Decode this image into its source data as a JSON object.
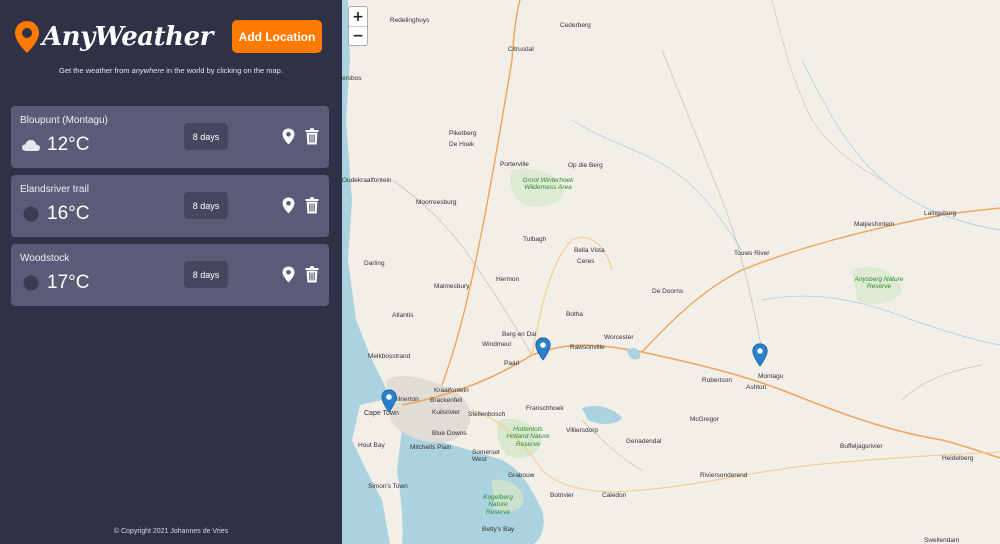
{
  "app": {
    "title": "AnyWeather",
    "add_button": "Add Location",
    "tagline_before": "Get the weather from ",
    "tagline_em": "anywhere",
    "tagline_after": " in the world by clicking on the map.",
    "copyright": "© Copyright 2021 Johannes de Vries",
    "accent_color": "#ff7a00",
    "sidebar_color": "#2f3146",
    "card_color": "#5a5b77"
  },
  "locations": [
    {
      "name": "Bloupunt (Montagu)",
      "temp": "12°C",
      "icon": "cloud-icon",
      "days": "8 days"
    },
    {
      "name": "Elandsriver trail",
      "temp": "16°C",
      "icon": "unknown-weather-icon",
      "days": "8 days"
    },
    {
      "name": "Woodstock",
      "temp": "17°C",
      "icon": "unknown-weather-icon",
      "days": "8 days"
    }
  ],
  "map": {
    "zoom_in": "+",
    "zoom_out": "−",
    "labels": {
      "redelinghuys": "Redelinghuys",
      "cederberg": "Cederberg",
      "citrusdal": "Citrusdal",
      "lambertsbay": "ersbos",
      "piketberg": "Piketberg",
      "dehoek": "De Hoek",
      "porterville": "Porterville",
      "opdieberg": "Op die Berg",
      "groot": "Groot Winterhoek Wilderness Area",
      "oudekraal": "Oudekraalfontein",
      "moorreesburg": "Moorreesburg",
      "tulbagh": "Tulbagh",
      "bellavista": "Bella Vista",
      "ceres": "Ceres",
      "darling": "Darling",
      "hermon": "Hermon",
      "touwsrivier": "Touws River",
      "matjiesfontein": "Matjiesfontein",
      "laingsburg": "Laingsburg",
      "anysberg": "Anysberg Nature Reserve",
      "malmesbury": "Malmesbury",
      "dedoorns": "De Doorns",
      "atlantis": "Atlantis",
      "botha": "Botha",
      "bergendal": "Berg en Dal",
      "windmeul": "Windmeul",
      "worcester": "Worcester",
      "rawsonville": "Rawsonville",
      "melkbos": "Melkbosstrand",
      "paarl": "Paarl",
      "montagu": "Montagu",
      "robertson": "Robertson",
      "ashton": "Ashton",
      "kraaifontein": "Kraaifontein",
      "milnerton": "Milnerton",
      "brackenfell": "Brackenfell",
      "kuilsrivier": "Kuilsrivier",
      "stellenbosch": "Stellenbosch",
      "franschhoek": "Franschhoek",
      "capetown": "Cape Town",
      "mcgregor": "McGregor",
      "villiersdorp": "Villiersdorp",
      "hottentots": "Hottentots Holland Nature Reserve",
      "bluedowns": "Blue Downs",
      "houtbay": "Hout Bay",
      "mitchells": "Mitchells Plain",
      "genadendal": "Genadendal",
      "somerset": "Somerset West",
      "buffeljag": "Buffeljagsrivier",
      "heidelberg": "Heidelberg",
      "grabouw": "Grabouw",
      "riviersonderend": "Riviersonderend",
      "simonstown": "Simon's Town",
      "kogelberg": "Kogelberg Nature Reserve",
      "botrivier": "Botrivier",
      "caledon": "Caledon",
      "bettysbay": "Betty's Bay",
      "swellendam": "Swellendam"
    }
  }
}
